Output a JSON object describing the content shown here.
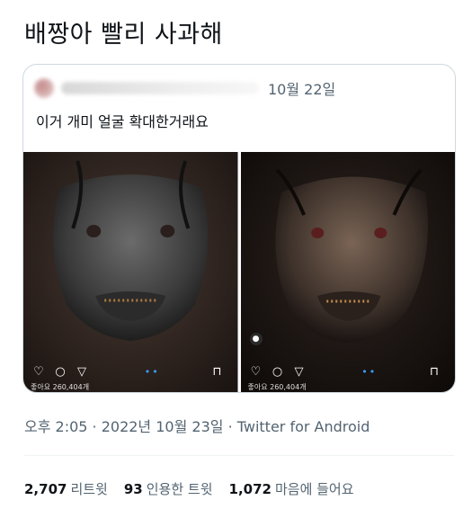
{
  "tweet": {
    "text": "배짱아 빨리 사과해"
  },
  "quote": {
    "date": "10월 22일",
    "text": "이거 개미 얼굴 확대한거래요",
    "photos": [
      {
        "likes": "좋아요 260,404개"
      },
      {
        "likes": "좋아요 260,404개"
      }
    ]
  },
  "meta": {
    "timestamp": "오후 2:05 · 2022년 10월 23일 · Twitter for Android"
  },
  "stats": {
    "retweets_count": "2,707",
    "retweets_label": "리트윗",
    "quotes_count": "93",
    "quotes_label": "인용한 트윗",
    "likes_count": "1,072",
    "likes_label": "마음에 들어요"
  },
  "colors": {
    "text_primary": "#0f1419",
    "text_secondary": "#536471",
    "border": "#cfd9de"
  }
}
